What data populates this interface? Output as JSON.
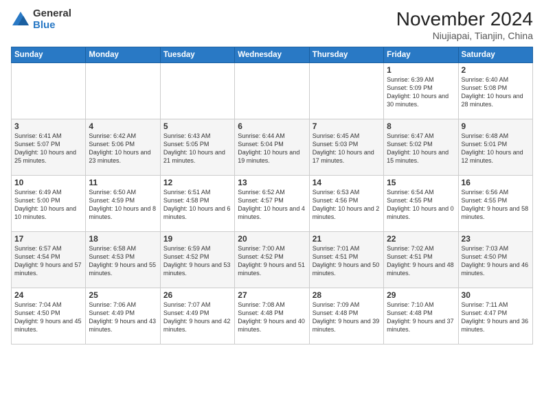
{
  "logo": {
    "general": "General",
    "blue": "Blue"
  },
  "header": {
    "month": "November 2024",
    "location": "Niujiapai, Tianjin, China"
  },
  "days_of_week": [
    "Sunday",
    "Monday",
    "Tuesday",
    "Wednesday",
    "Thursday",
    "Friday",
    "Saturday"
  ],
  "weeks": [
    [
      {
        "day": "",
        "info": ""
      },
      {
        "day": "",
        "info": ""
      },
      {
        "day": "",
        "info": ""
      },
      {
        "day": "",
        "info": ""
      },
      {
        "day": "",
        "info": ""
      },
      {
        "day": "1",
        "info": "Sunrise: 6:39 AM\nSunset: 5:09 PM\nDaylight: 10 hours and 30 minutes."
      },
      {
        "day": "2",
        "info": "Sunrise: 6:40 AM\nSunset: 5:08 PM\nDaylight: 10 hours and 28 minutes."
      }
    ],
    [
      {
        "day": "3",
        "info": "Sunrise: 6:41 AM\nSunset: 5:07 PM\nDaylight: 10 hours and 25 minutes."
      },
      {
        "day": "4",
        "info": "Sunrise: 6:42 AM\nSunset: 5:06 PM\nDaylight: 10 hours and 23 minutes."
      },
      {
        "day": "5",
        "info": "Sunrise: 6:43 AM\nSunset: 5:05 PM\nDaylight: 10 hours and 21 minutes."
      },
      {
        "day": "6",
        "info": "Sunrise: 6:44 AM\nSunset: 5:04 PM\nDaylight: 10 hours and 19 minutes."
      },
      {
        "day": "7",
        "info": "Sunrise: 6:45 AM\nSunset: 5:03 PM\nDaylight: 10 hours and 17 minutes."
      },
      {
        "day": "8",
        "info": "Sunrise: 6:47 AM\nSunset: 5:02 PM\nDaylight: 10 hours and 15 minutes."
      },
      {
        "day": "9",
        "info": "Sunrise: 6:48 AM\nSunset: 5:01 PM\nDaylight: 10 hours and 12 minutes."
      }
    ],
    [
      {
        "day": "10",
        "info": "Sunrise: 6:49 AM\nSunset: 5:00 PM\nDaylight: 10 hours and 10 minutes."
      },
      {
        "day": "11",
        "info": "Sunrise: 6:50 AM\nSunset: 4:59 PM\nDaylight: 10 hours and 8 minutes."
      },
      {
        "day": "12",
        "info": "Sunrise: 6:51 AM\nSunset: 4:58 PM\nDaylight: 10 hours and 6 minutes."
      },
      {
        "day": "13",
        "info": "Sunrise: 6:52 AM\nSunset: 4:57 PM\nDaylight: 10 hours and 4 minutes."
      },
      {
        "day": "14",
        "info": "Sunrise: 6:53 AM\nSunset: 4:56 PM\nDaylight: 10 hours and 2 minutes."
      },
      {
        "day": "15",
        "info": "Sunrise: 6:54 AM\nSunset: 4:55 PM\nDaylight: 10 hours and 0 minutes."
      },
      {
        "day": "16",
        "info": "Sunrise: 6:56 AM\nSunset: 4:55 PM\nDaylight: 9 hours and 58 minutes."
      }
    ],
    [
      {
        "day": "17",
        "info": "Sunrise: 6:57 AM\nSunset: 4:54 PM\nDaylight: 9 hours and 57 minutes."
      },
      {
        "day": "18",
        "info": "Sunrise: 6:58 AM\nSunset: 4:53 PM\nDaylight: 9 hours and 55 minutes."
      },
      {
        "day": "19",
        "info": "Sunrise: 6:59 AM\nSunset: 4:52 PM\nDaylight: 9 hours and 53 minutes."
      },
      {
        "day": "20",
        "info": "Sunrise: 7:00 AM\nSunset: 4:52 PM\nDaylight: 9 hours and 51 minutes."
      },
      {
        "day": "21",
        "info": "Sunrise: 7:01 AM\nSunset: 4:51 PM\nDaylight: 9 hours and 50 minutes."
      },
      {
        "day": "22",
        "info": "Sunrise: 7:02 AM\nSunset: 4:51 PM\nDaylight: 9 hours and 48 minutes."
      },
      {
        "day": "23",
        "info": "Sunrise: 7:03 AM\nSunset: 4:50 PM\nDaylight: 9 hours and 46 minutes."
      }
    ],
    [
      {
        "day": "24",
        "info": "Sunrise: 7:04 AM\nSunset: 4:50 PM\nDaylight: 9 hours and 45 minutes."
      },
      {
        "day": "25",
        "info": "Sunrise: 7:06 AM\nSunset: 4:49 PM\nDaylight: 9 hours and 43 minutes."
      },
      {
        "day": "26",
        "info": "Sunrise: 7:07 AM\nSunset: 4:49 PM\nDaylight: 9 hours and 42 minutes."
      },
      {
        "day": "27",
        "info": "Sunrise: 7:08 AM\nSunset: 4:48 PM\nDaylight: 9 hours and 40 minutes."
      },
      {
        "day": "28",
        "info": "Sunrise: 7:09 AM\nSunset: 4:48 PM\nDaylight: 9 hours and 39 minutes."
      },
      {
        "day": "29",
        "info": "Sunrise: 7:10 AM\nSunset: 4:48 PM\nDaylight: 9 hours and 37 minutes."
      },
      {
        "day": "30",
        "info": "Sunrise: 7:11 AM\nSunset: 4:47 PM\nDaylight: 9 hours and 36 minutes."
      }
    ]
  ]
}
